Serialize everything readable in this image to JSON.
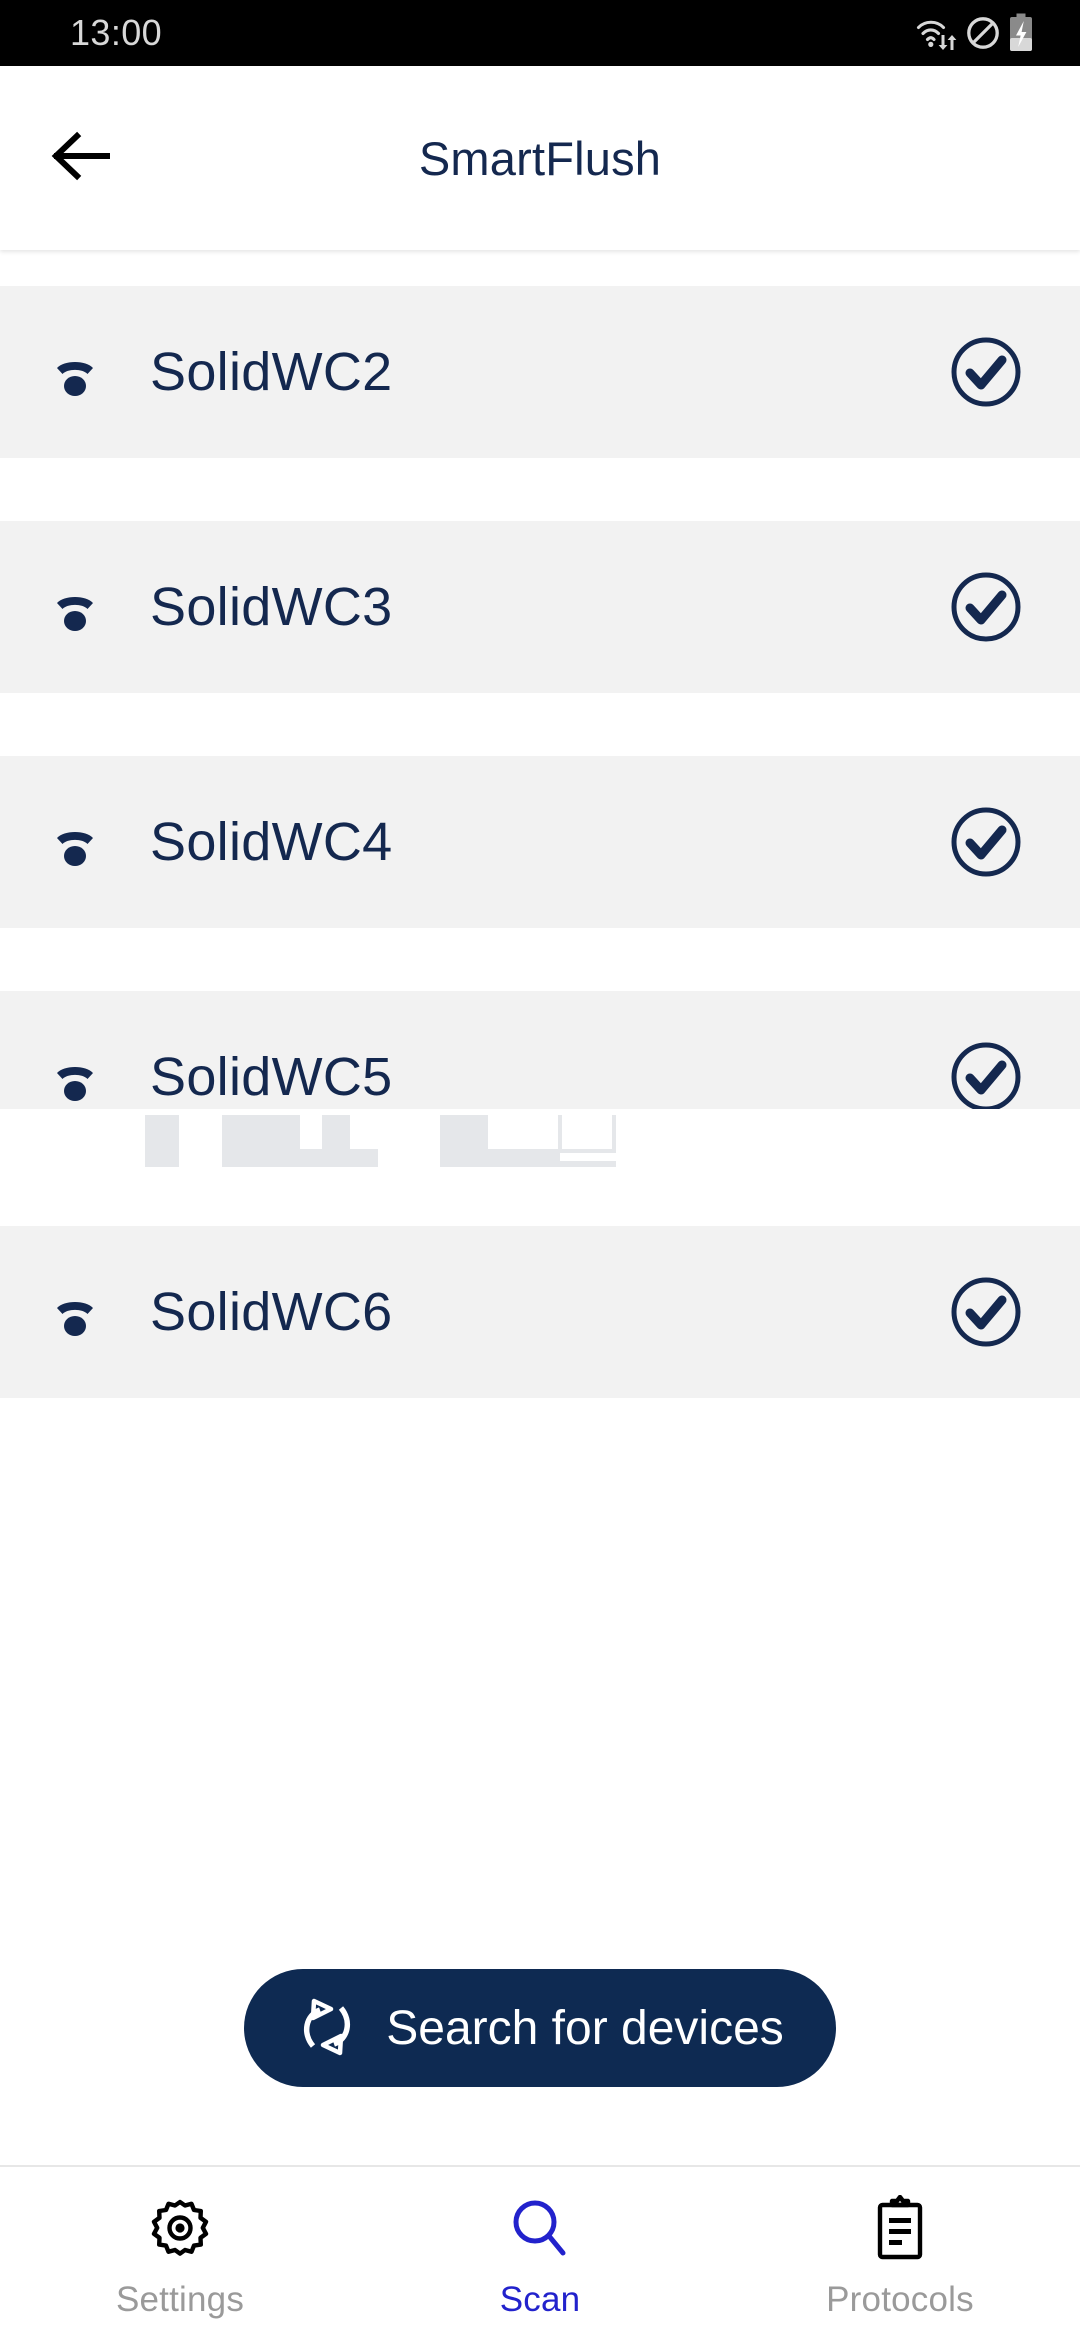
{
  "status_bar": {
    "time": "13:00",
    "icons": [
      {
        "name": "wifi-transfer-icon",
        "glyph": "wifi"
      },
      {
        "name": "do-not-disturb-icon",
        "glyph": "no-entry"
      },
      {
        "name": "battery-charging-icon",
        "glyph": "battery-charging"
      }
    ],
    "background_color": "#000000",
    "text_color": "#d8d8d8"
  },
  "header": {
    "title": "SmartFlush",
    "back_icon": "arrow-left-icon",
    "title_color": "#14284f"
  },
  "devices": {
    "row_background": "#f2f2f2",
    "signal_icon": "wifi-signal-low-icon",
    "check_icon": "check-circle-icon",
    "accent_color": "#14284f",
    "items": [
      {
        "name": "SolidWC2",
        "paired": true
      },
      {
        "name": "SolidWC3",
        "paired": true
      },
      {
        "name": "SolidWC4",
        "paired": true
      },
      {
        "name": "SolidWC5",
        "paired": true
      },
      {
        "name": "SolidWC6",
        "paired": true
      }
    ]
  },
  "search_button": {
    "label": "Search for devices",
    "icon": "refresh-sync-icon",
    "background_color": "#0e2a52",
    "text_color": "#ffffff"
  },
  "bottom_nav": {
    "active_color": "#2222cc",
    "inactive_color": "#9a9a9a",
    "items": [
      {
        "label": "Settings",
        "icon": "gear-icon",
        "active": false
      },
      {
        "label": "Scan",
        "icon": "magnifier-icon",
        "active": true
      },
      {
        "label": "Protocols",
        "icon": "clipboard-list-icon",
        "active": false
      }
    ]
  }
}
